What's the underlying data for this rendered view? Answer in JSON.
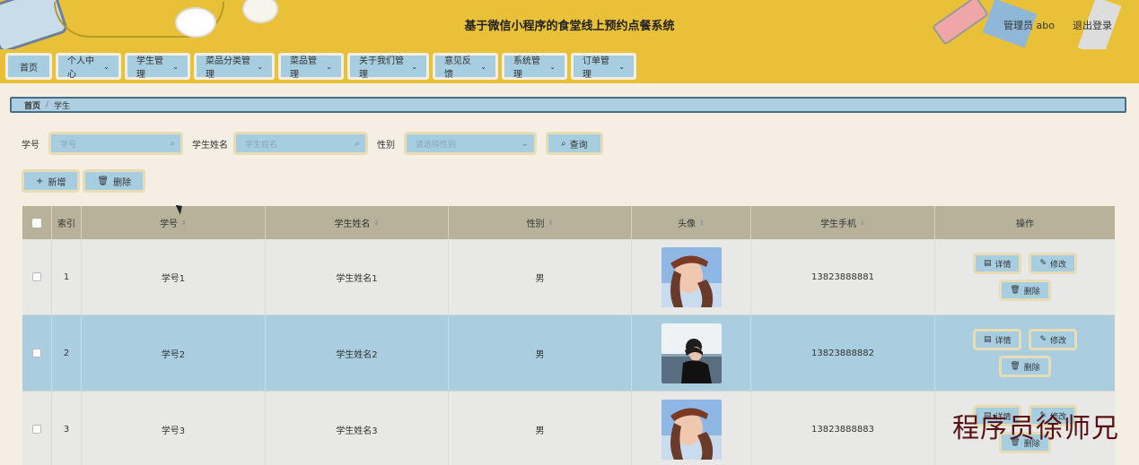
{
  "header": {
    "title": "基于微信小程序的食堂线上预约点餐系统",
    "admin_label": "管理员 abo",
    "logout_label": "退出登录"
  },
  "nav": {
    "items": [
      {
        "label": "首页",
        "dropdown": false
      },
      {
        "label": "个人中心",
        "dropdown": true
      },
      {
        "label": "学生管理",
        "dropdown": true
      },
      {
        "label": "菜品分类管理",
        "dropdown": true
      },
      {
        "label": "菜品管理",
        "dropdown": true
      },
      {
        "label": "关于我们管理",
        "dropdown": true
      },
      {
        "label": "意见反馈",
        "dropdown": true
      },
      {
        "label": "系统管理",
        "dropdown": true
      },
      {
        "label": "订单管理",
        "dropdown": true
      }
    ]
  },
  "breadcrumb": {
    "home": "首页",
    "separator": "/",
    "current": "学生"
  },
  "search": {
    "student_id_label": "学号",
    "student_id_placeholder": "学号",
    "student_name_label": "学生姓名",
    "student_name_placeholder": "学生姓名",
    "gender_label": "性别",
    "gender_placeholder": "请选择性别",
    "query_label": "查询"
  },
  "actions": {
    "add_label": "新增",
    "delete_label": "删除"
  },
  "table": {
    "headers": [
      "索引",
      "学号",
      "学生姓名",
      "性别",
      "头像",
      "学生手机",
      "操作"
    ],
    "rows": [
      {
        "index": "1",
        "student_id": "学号1",
        "name": "学生姓名1",
        "gender": "男",
        "phone": "13823888881"
      },
      {
        "index": "2",
        "student_id": "学号2",
        "name": "学生姓名2",
        "gender": "男",
        "phone": "13823888882"
      },
      {
        "index": "3",
        "student_id": "学号3",
        "name": "学生姓名3",
        "gender": "男",
        "phone": "13823888883"
      }
    ],
    "op_labels": {
      "detail": "详情",
      "edit": "修改",
      "delete": "删除"
    }
  },
  "watermark": "程序员徐师兄",
  "colors": {
    "header_bg": "#e9c139",
    "button_bg": "#a7cde0",
    "highlight_row": "#aacde0",
    "table_header": "#b6b39a"
  }
}
